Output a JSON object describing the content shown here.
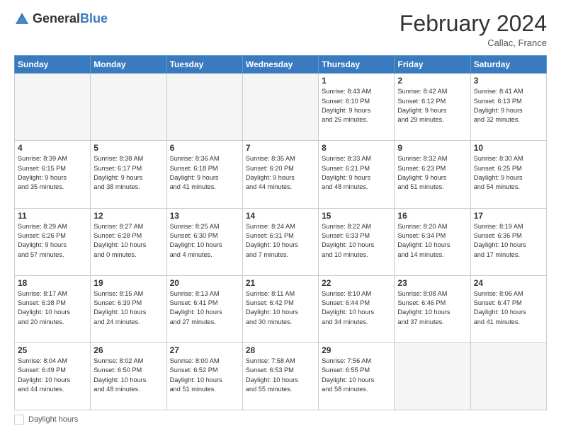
{
  "logo": {
    "general": "General",
    "blue": "Blue"
  },
  "header": {
    "month": "February 2024",
    "location": "Callac, France"
  },
  "days_of_week": [
    "Sunday",
    "Monday",
    "Tuesday",
    "Wednesday",
    "Thursday",
    "Friday",
    "Saturday"
  ],
  "weeks": [
    [
      {
        "day": "",
        "info": ""
      },
      {
        "day": "",
        "info": ""
      },
      {
        "day": "",
        "info": ""
      },
      {
        "day": "",
        "info": ""
      },
      {
        "day": "1",
        "info": "Sunrise: 8:43 AM\nSunset: 6:10 PM\nDaylight: 9 hours\nand 26 minutes."
      },
      {
        "day": "2",
        "info": "Sunrise: 8:42 AM\nSunset: 6:12 PM\nDaylight: 9 hours\nand 29 minutes."
      },
      {
        "day": "3",
        "info": "Sunrise: 8:41 AM\nSunset: 6:13 PM\nDaylight: 9 hours\nand 32 minutes."
      }
    ],
    [
      {
        "day": "4",
        "info": "Sunrise: 8:39 AM\nSunset: 6:15 PM\nDaylight: 9 hours\nand 35 minutes."
      },
      {
        "day": "5",
        "info": "Sunrise: 8:38 AM\nSunset: 6:17 PM\nDaylight: 9 hours\nand 38 minutes."
      },
      {
        "day": "6",
        "info": "Sunrise: 8:36 AM\nSunset: 6:18 PM\nDaylight: 9 hours\nand 41 minutes."
      },
      {
        "day": "7",
        "info": "Sunrise: 8:35 AM\nSunset: 6:20 PM\nDaylight: 9 hours\nand 44 minutes."
      },
      {
        "day": "8",
        "info": "Sunrise: 8:33 AM\nSunset: 6:21 PM\nDaylight: 9 hours\nand 48 minutes."
      },
      {
        "day": "9",
        "info": "Sunrise: 8:32 AM\nSunset: 6:23 PM\nDaylight: 9 hours\nand 51 minutes."
      },
      {
        "day": "10",
        "info": "Sunrise: 8:30 AM\nSunset: 6:25 PM\nDaylight: 9 hours\nand 54 minutes."
      }
    ],
    [
      {
        "day": "11",
        "info": "Sunrise: 8:29 AM\nSunset: 6:26 PM\nDaylight: 9 hours\nand 57 minutes."
      },
      {
        "day": "12",
        "info": "Sunrise: 8:27 AM\nSunset: 6:28 PM\nDaylight: 10 hours\nand 0 minutes."
      },
      {
        "day": "13",
        "info": "Sunrise: 8:25 AM\nSunset: 6:30 PM\nDaylight: 10 hours\nand 4 minutes."
      },
      {
        "day": "14",
        "info": "Sunrise: 8:24 AM\nSunset: 6:31 PM\nDaylight: 10 hours\nand 7 minutes."
      },
      {
        "day": "15",
        "info": "Sunrise: 8:22 AM\nSunset: 6:33 PM\nDaylight: 10 hours\nand 10 minutes."
      },
      {
        "day": "16",
        "info": "Sunrise: 8:20 AM\nSunset: 6:34 PM\nDaylight: 10 hours\nand 14 minutes."
      },
      {
        "day": "17",
        "info": "Sunrise: 8:19 AM\nSunset: 6:36 PM\nDaylight: 10 hours\nand 17 minutes."
      }
    ],
    [
      {
        "day": "18",
        "info": "Sunrise: 8:17 AM\nSunset: 6:38 PM\nDaylight: 10 hours\nand 20 minutes."
      },
      {
        "day": "19",
        "info": "Sunrise: 8:15 AM\nSunset: 6:39 PM\nDaylight: 10 hours\nand 24 minutes."
      },
      {
        "day": "20",
        "info": "Sunrise: 8:13 AM\nSunset: 6:41 PM\nDaylight: 10 hours\nand 27 minutes."
      },
      {
        "day": "21",
        "info": "Sunrise: 8:11 AM\nSunset: 6:42 PM\nDaylight: 10 hours\nand 30 minutes."
      },
      {
        "day": "22",
        "info": "Sunrise: 8:10 AM\nSunset: 6:44 PM\nDaylight: 10 hours\nand 34 minutes."
      },
      {
        "day": "23",
        "info": "Sunrise: 8:08 AM\nSunset: 6:46 PM\nDaylight: 10 hours\nand 37 minutes."
      },
      {
        "day": "24",
        "info": "Sunrise: 8:06 AM\nSunset: 6:47 PM\nDaylight: 10 hours\nand 41 minutes."
      }
    ],
    [
      {
        "day": "25",
        "info": "Sunrise: 8:04 AM\nSunset: 6:49 PM\nDaylight: 10 hours\nand 44 minutes."
      },
      {
        "day": "26",
        "info": "Sunrise: 8:02 AM\nSunset: 6:50 PM\nDaylight: 10 hours\nand 48 minutes."
      },
      {
        "day": "27",
        "info": "Sunrise: 8:00 AM\nSunset: 6:52 PM\nDaylight: 10 hours\nand 51 minutes."
      },
      {
        "day": "28",
        "info": "Sunrise: 7:58 AM\nSunset: 6:53 PM\nDaylight: 10 hours\nand 55 minutes."
      },
      {
        "day": "29",
        "info": "Sunrise: 7:56 AM\nSunset: 6:55 PM\nDaylight: 10 hours\nand 58 minutes."
      },
      {
        "day": "",
        "info": ""
      },
      {
        "day": "",
        "info": ""
      }
    ]
  ],
  "footer": {
    "label": "Daylight hours"
  }
}
